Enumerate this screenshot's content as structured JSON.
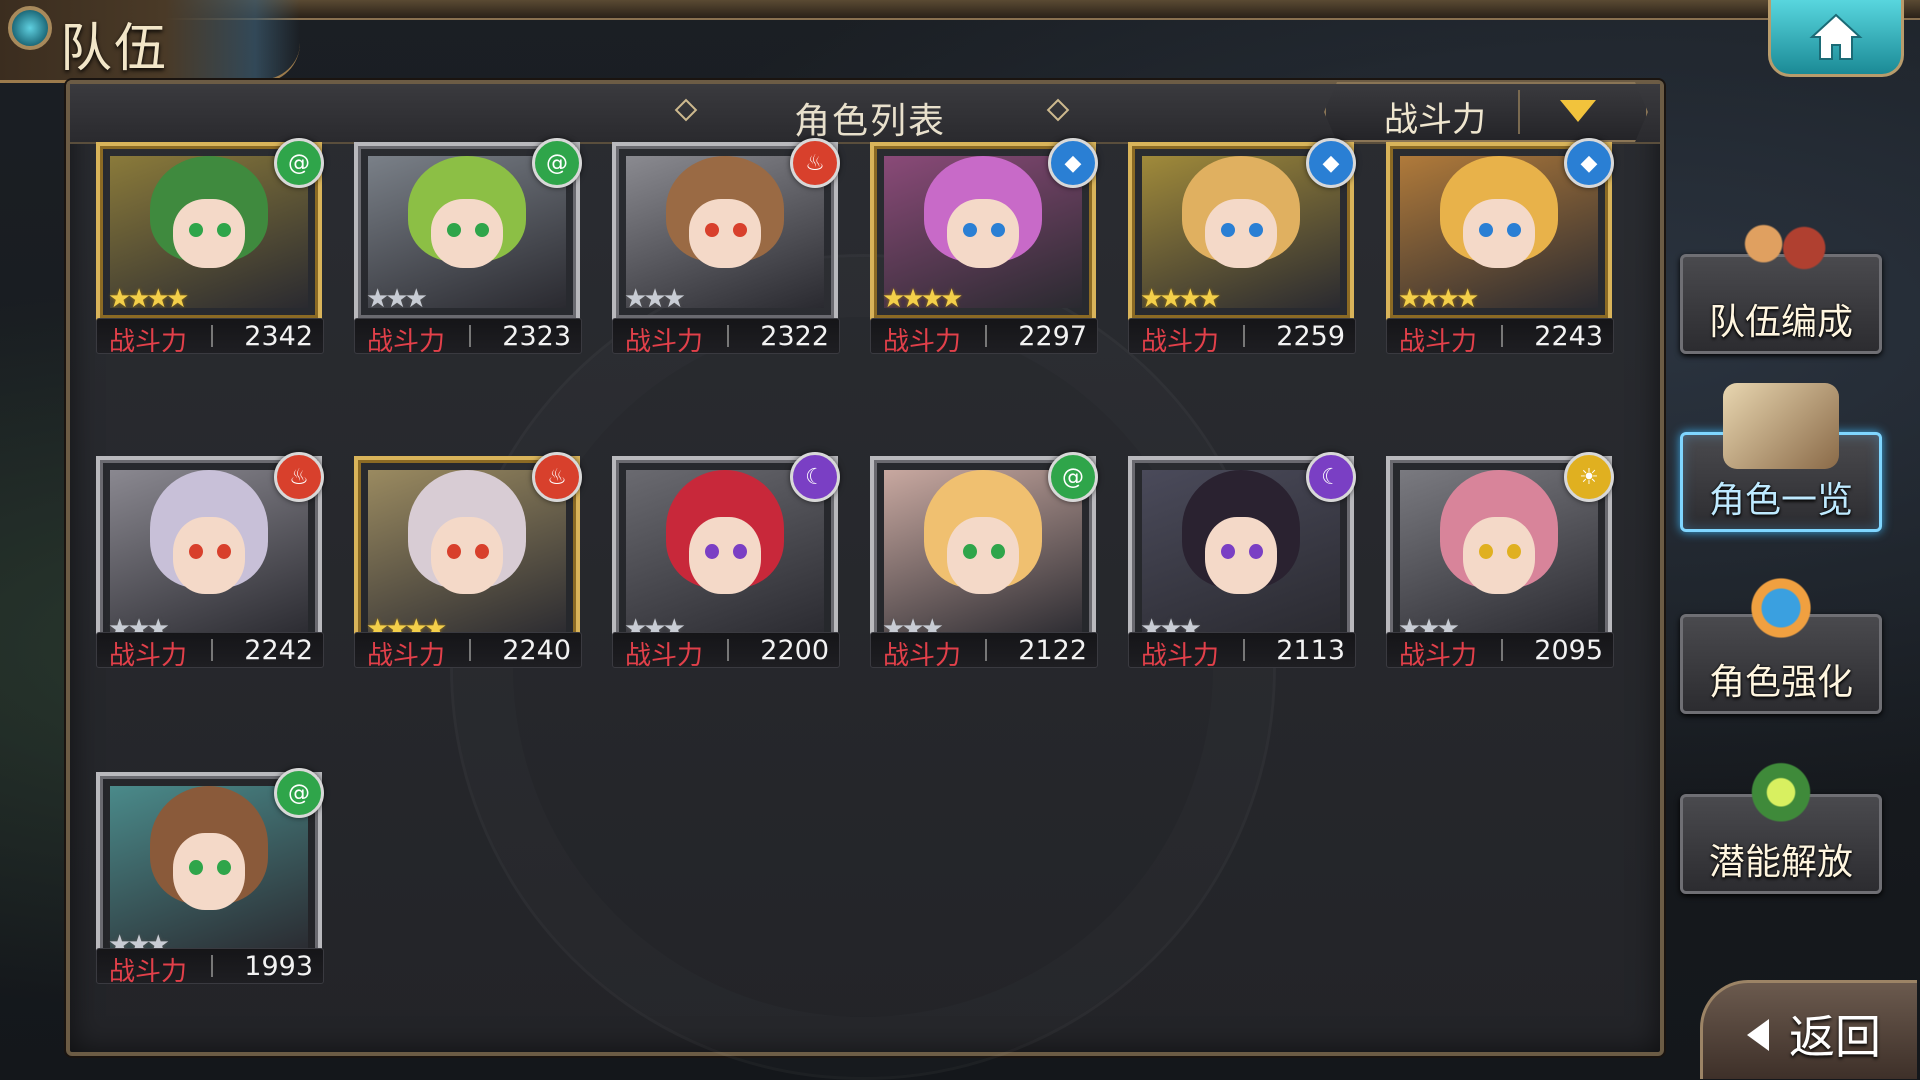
{
  "header": {
    "title": "队伍"
  },
  "panel": {
    "title": "角色列表",
    "sort_label": "战斗力"
  },
  "power_label": "战斗力",
  "characters": [
    {
      "power": "2342",
      "element": "wind",
      "stars": 4,
      "max_stars": 4,
      "frame": "gold"
    },
    {
      "power": "2323",
      "element": "wind",
      "stars": 0,
      "max_stars": 3,
      "frame": "silver"
    },
    {
      "power": "2322",
      "element": "fire",
      "stars": 0,
      "max_stars": 3,
      "frame": "silver"
    },
    {
      "power": "2297",
      "element": "water",
      "stars": 4,
      "max_stars": 4,
      "frame": "gold"
    },
    {
      "power": "2259",
      "element": "water",
      "stars": 4,
      "max_stars": 4,
      "frame": "gold"
    },
    {
      "power": "2243",
      "element": "water",
      "stars": 4,
      "max_stars": 4,
      "frame": "gold"
    },
    {
      "power": "2242",
      "element": "fire",
      "stars": 0,
      "max_stars": 3,
      "frame": "silver"
    },
    {
      "power": "2240",
      "element": "fire",
      "stars": 4,
      "max_stars": 4,
      "frame": "gold"
    },
    {
      "power": "2200",
      "element": "dark",
      "stars": 0,
      "max_stars": 3,
      "frame": "silver"
    },
    {
      "power": "2122",
      "element": "wind",
      "stars": 0,
      "max_stars": 3,
      "frame": "silver"
    },
    {
      "power": "2113",
      "element": "dark",
      "stars": 0,
      "max_stars": 3,
      "frame": "silver"
    },
    {
      "power": "2095",
      "element": "light",
      "stars": 0,
      "max_stars": 3,
      "frame": "silver"
    },
    {
      "power": "1993",
      "element": "wind",
      "stars": 0,
      "max_stars": 3,
      "frame": "silver"
    }
  ],
  "sidebar": {
    "items": [
      {
        "label": "队伍编成",
        "active": false
      },
      {
        "label": "角色一览",
        "active": true
      },
      {
        "label": "角色强化",
        "active": false
      },
      {
        "label": "潜能解放",
        "active": false
      }
    ]
  },
  "back": {
    "label": "返回"
  },
  "colors": {
    "power_label": "#e2404a",
    "wind": "#2fa54a",
    "fire": "#d8402c",
    "water": "#2a7fd4",
    "dark": "#7a3fc4",
    "light": "#e0b020",
    "active_tab": "#7fd6ff"
  },
  "icons": {
    "home": "home-icon",
    "back": "back-arrow-icon",
    "sort": "dropdown-triangle-icon"
  }
}
